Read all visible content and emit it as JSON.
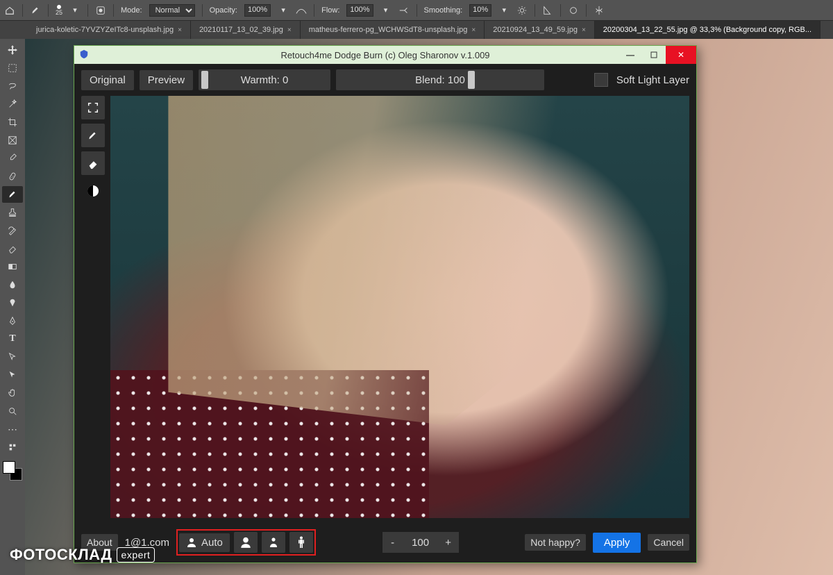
{
  "ps_options": {
    "brush_size": "25",
    "mode_label": "Mode:",
    "mode_value": "Normal",
    "opacity_label": "Opacity:",
    "opacity_value": "100%",
    "flow_label": "Flow:",
    "flow_value": "100%",
    "smoothing_label": "Smoothing:",
    "smoothing_value": "10%"
  },
  "ps_tabs": [
    {
      "label": "jurica-koletic-7YVZYZeITc8-unsplash.jpg",
      "active": false
    },
    {
      "label": "20210117_13_02_39.jpg",
      "active": false
    },
    {
      "label": "matheus-ferrero-pg_WCHWSdT8-unsplash.jpg",
      "active": false
    },
    {
      "label": "20210924_13_49_59.jpg",
      "active": false
    },
    {
      "label": "20200304_13_22_55.jpg @ 33,3% (Background copy, RGB...",
      "active": true
    }
  ],
  "plugin": {
    "title": "Retouch4me Dodge Burn (c) Oleg Sharonov v.1.009",
    "top": {
      "original": "Original",
      "preview": "Preview",
      "warmth_label": "Warmth: 0",
      "blend_label": "Blend: 100",
      "soft_light": "Soft Light Layer"
    },
    "bottom": {
      "about": "About",
      "email": "1@1.com",
      "auto": "Auto",
      "scale_value": "100",
      "not_happy": "Not happy?",
      "apply": "Apply",
      "cancel": "Cancel",
      "minus": "-",
      "plus": "+"
    }
  },
  "watermark": {
    "brand": "ФОТОСКЛАД",
    "tag": "expert"
  }
}
